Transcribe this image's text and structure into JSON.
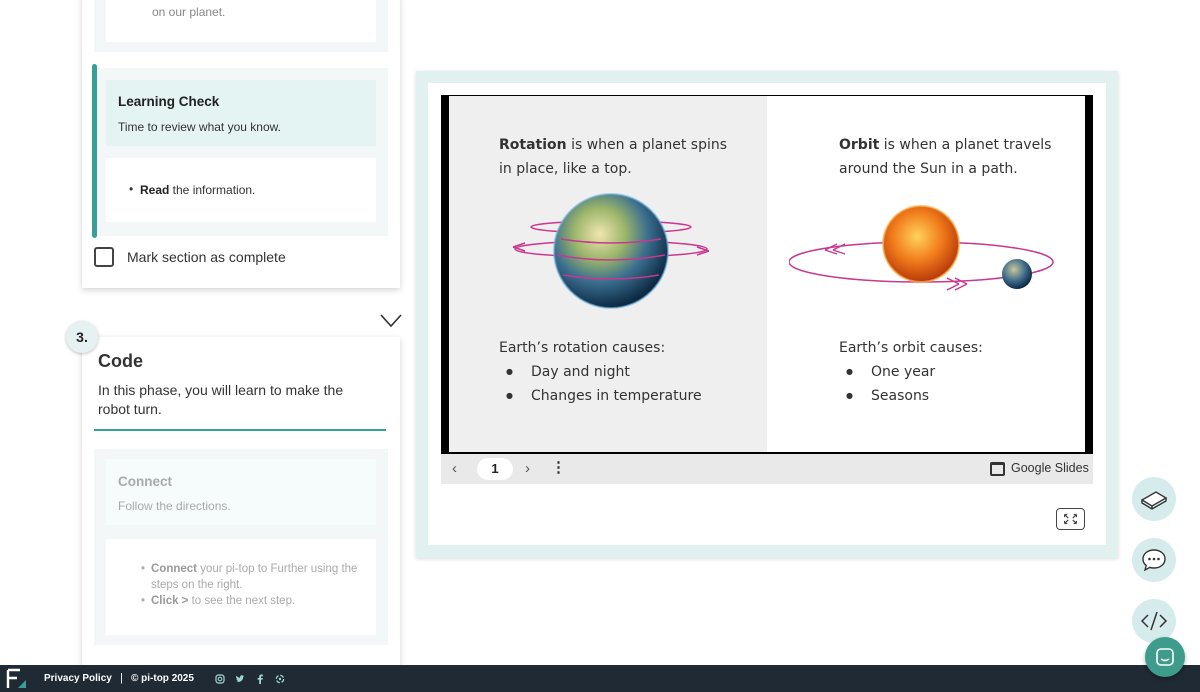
{
  "section_top": {
    "snippet": "on our planet."
  },
  "learning_check": {
    "title": "Learning Check",
    "subtitle": "Time to review what you know.",
    "bullet_bold": "Read",
    "bullet_rest": " the information."
  },
  "mark_complete": {
    "label": "Mark section as complete"
  },
  "section3": {
    "number": "3.",
    "title": "Code",
    "description": "In this phase, you will learn to make the robot turn."
  },
  "connect": {
    "title": "Connect",
    "subtitle": "Follow the directions.",
    "items": [
      {
        "bold": "Connect",
        "rest": " your pi-top to Further using the steps on the right."
      },
      {
        "bold": "Click >",
        "rest": " to see the next step."
      }
    ]
  },
  "slide": {
    "left": {
      "intro_bold": "Rotation",
      "intro_rest": " is when a planet spins in place, like a top.",
      "causes_title": "Earth’s rotation causes:",
      "causes": [
        "Day and night",
        "Changes in temperature"
      ]
    },
    "right": {
      "intro_bold": "Orbit",
      "intro_rest": " is when a planet travels around the Sun in a path.",
      "causes_title": "Earth’s orbit causes:",
      "causes": [
        "One year",
        "Seasons"
      ]
    }
  },
  "slides_bar": {
    "page_number": "1",
    "brand": "Google Slides"
  },
  "footer": {
    "privacy": "Privacy Policy",
    "separator": "|",
    "copyright": "© pi-top 2025",
    "social_icons": [
      "instagram-icon",
      "twitter-icon",
      "facebook-icon",
      "discord-icon"
    ]
  },
  "colors": {
    "accent_teal": "#3a9e98",
    "footer_bg": "#202a35",
    "orbit_magenta": "#c9378f",
    "chat_button": "#3d9c8c"
  }
}
